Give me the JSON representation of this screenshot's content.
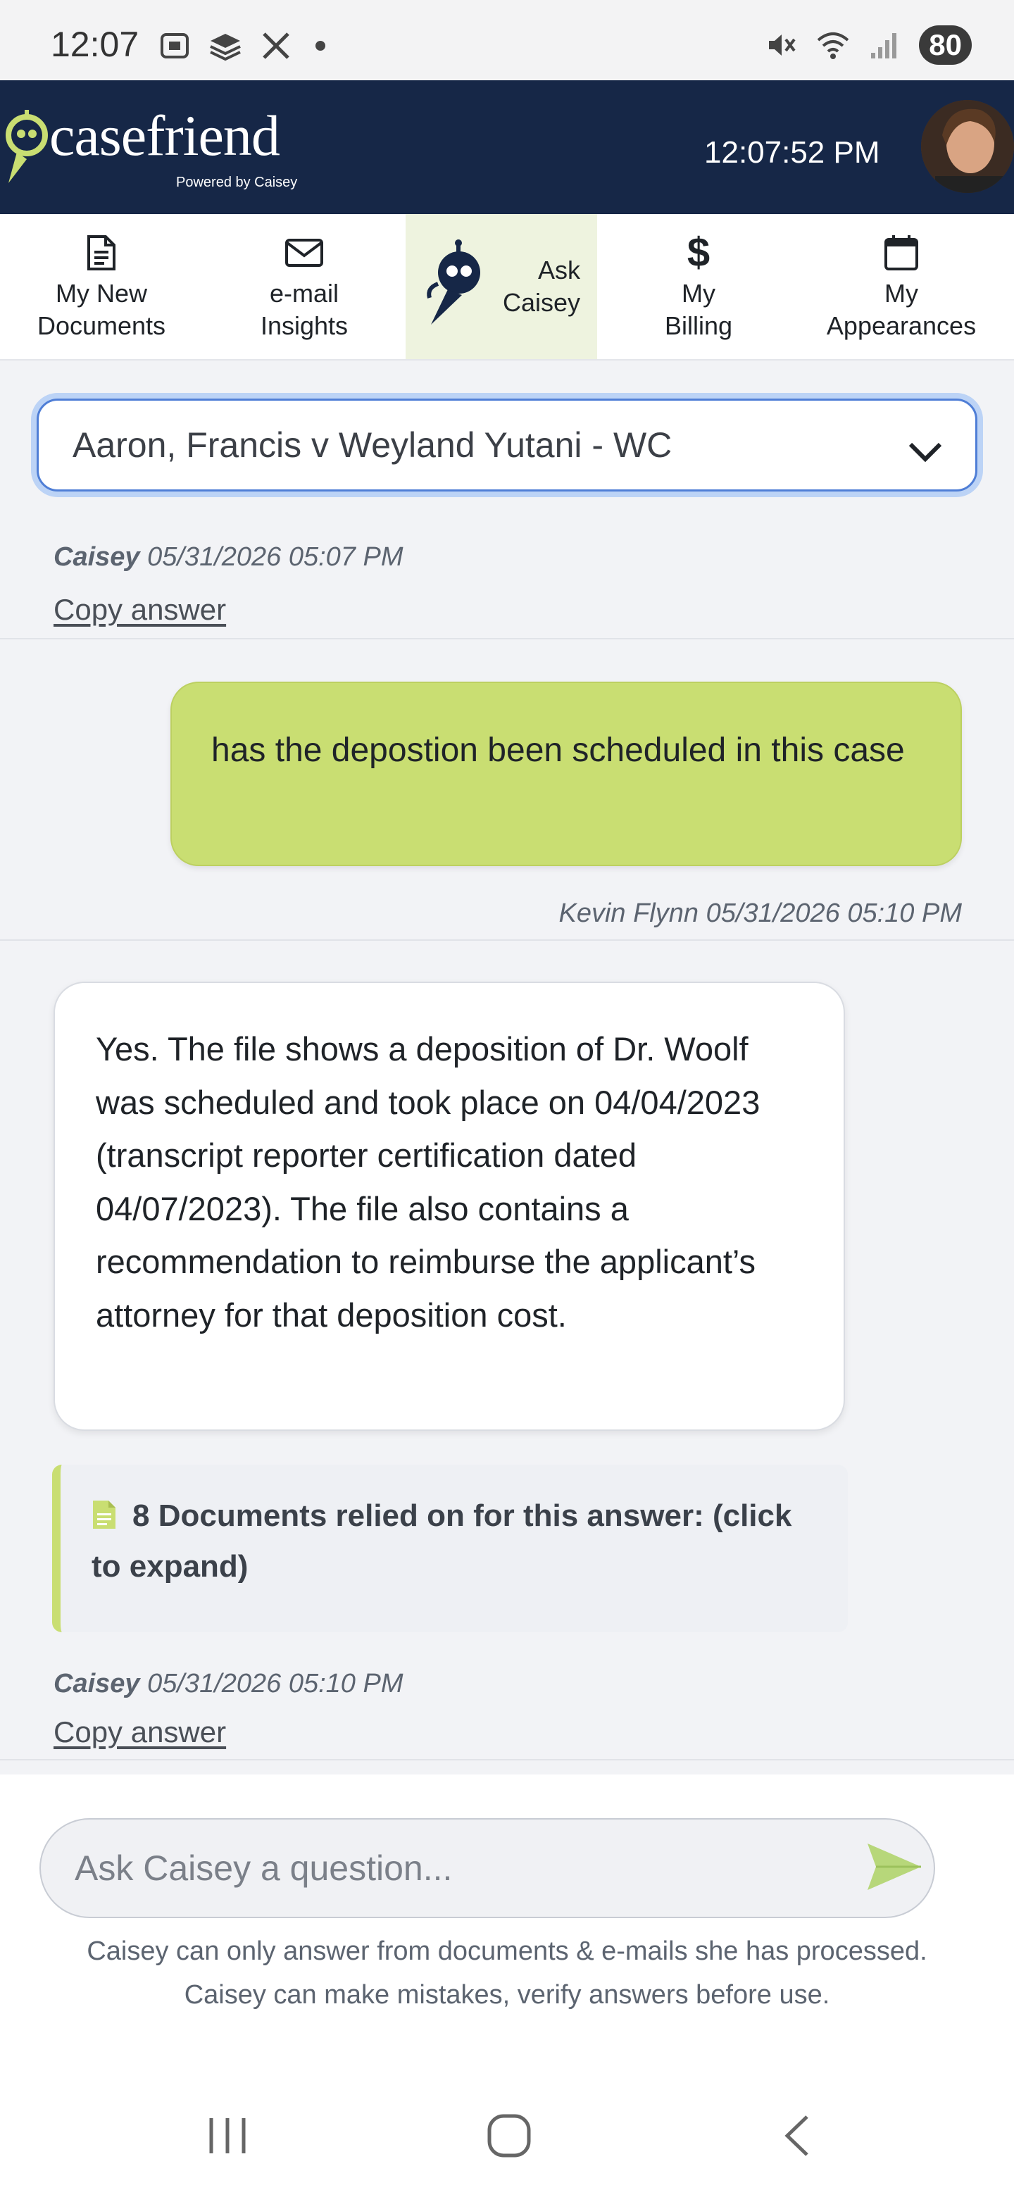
{
  "status_bar": {
    "time": "12:07",
    "battery": "80",
    "icons_left": [
      "screenshot-icon",
      "layers-icon",
      "x-icon",
      "dot-icon"
    ],
    "icons_right": [
      "mute-icon",
      "wifi-icon",
      "signal-icon",
      "battery-icon"
    ]
  },
  "header": {
    "logo_text": "casefriend",
    "logo_tagline": "Powered by Caisey",
    "clock": "12:07:52 PM"
  },
  "nav": {
    "tabs": [
      {
        "label": "My New\nDocuments",
        "icon": "document-icon"
      },
      {
        "label": "e-mail\nInsights",
        "icon": "envelope-icon"
      },
      {
        "label": "Ask\nCaisey",
        "icon": "robot-icon",
        "active": true
      },
      {
        "label": "My\nBilling",
        "icon": "dollar-icon"
      },
      {
        "label": "My\nAppearances",
        "icon": "calendar-icon"
      }
    ]
  },
  "case_select": {
    "value": "Aaron, Francis v Weyland Yutani - WC"
  },
  "chat": {
    "prev_meta": {
      "author": "Caisey",
      "timestamp": "05/31/2026 05:07 PM"
    },
    "copy_label": "Copy answer",
    "user_message": {
      "text": "has the depostion been scheduled in this case",
      "author": "Kevin Flynn",
      "timestamp": "05/31/2026 05:10 PM"
    },
    "ai_message": {
      "text": "Yes. The file shows a deposition of Dr. Woolf was scheduled and took place on 04/04/2023 (transcript reporter certification dated 04/07/2023). The file also contains a recommendation to reimburse the applicant’s attorney for that deposition cost.",
      "author": "Caisey",
      "timestamp": "05/31/2026 05:10 PM"
    },
    "documents_note": "8 Documents relied on for this answer: (click to expand)"
  },
  "composer": {
    "placeholder": "Ask Caisey a question...",
    "disclaimer_line1": "Caisey can only answer from documents & e-mails she has processed.",
    "disclaimer_line2": "Caisey can make mistakes, verify answers before use."
  },
  "colors": {
    "header_bg": "#162747",
    "accent_green": "#c9de72",
    "focus_blue": "#4f7ed6"
  }
}
